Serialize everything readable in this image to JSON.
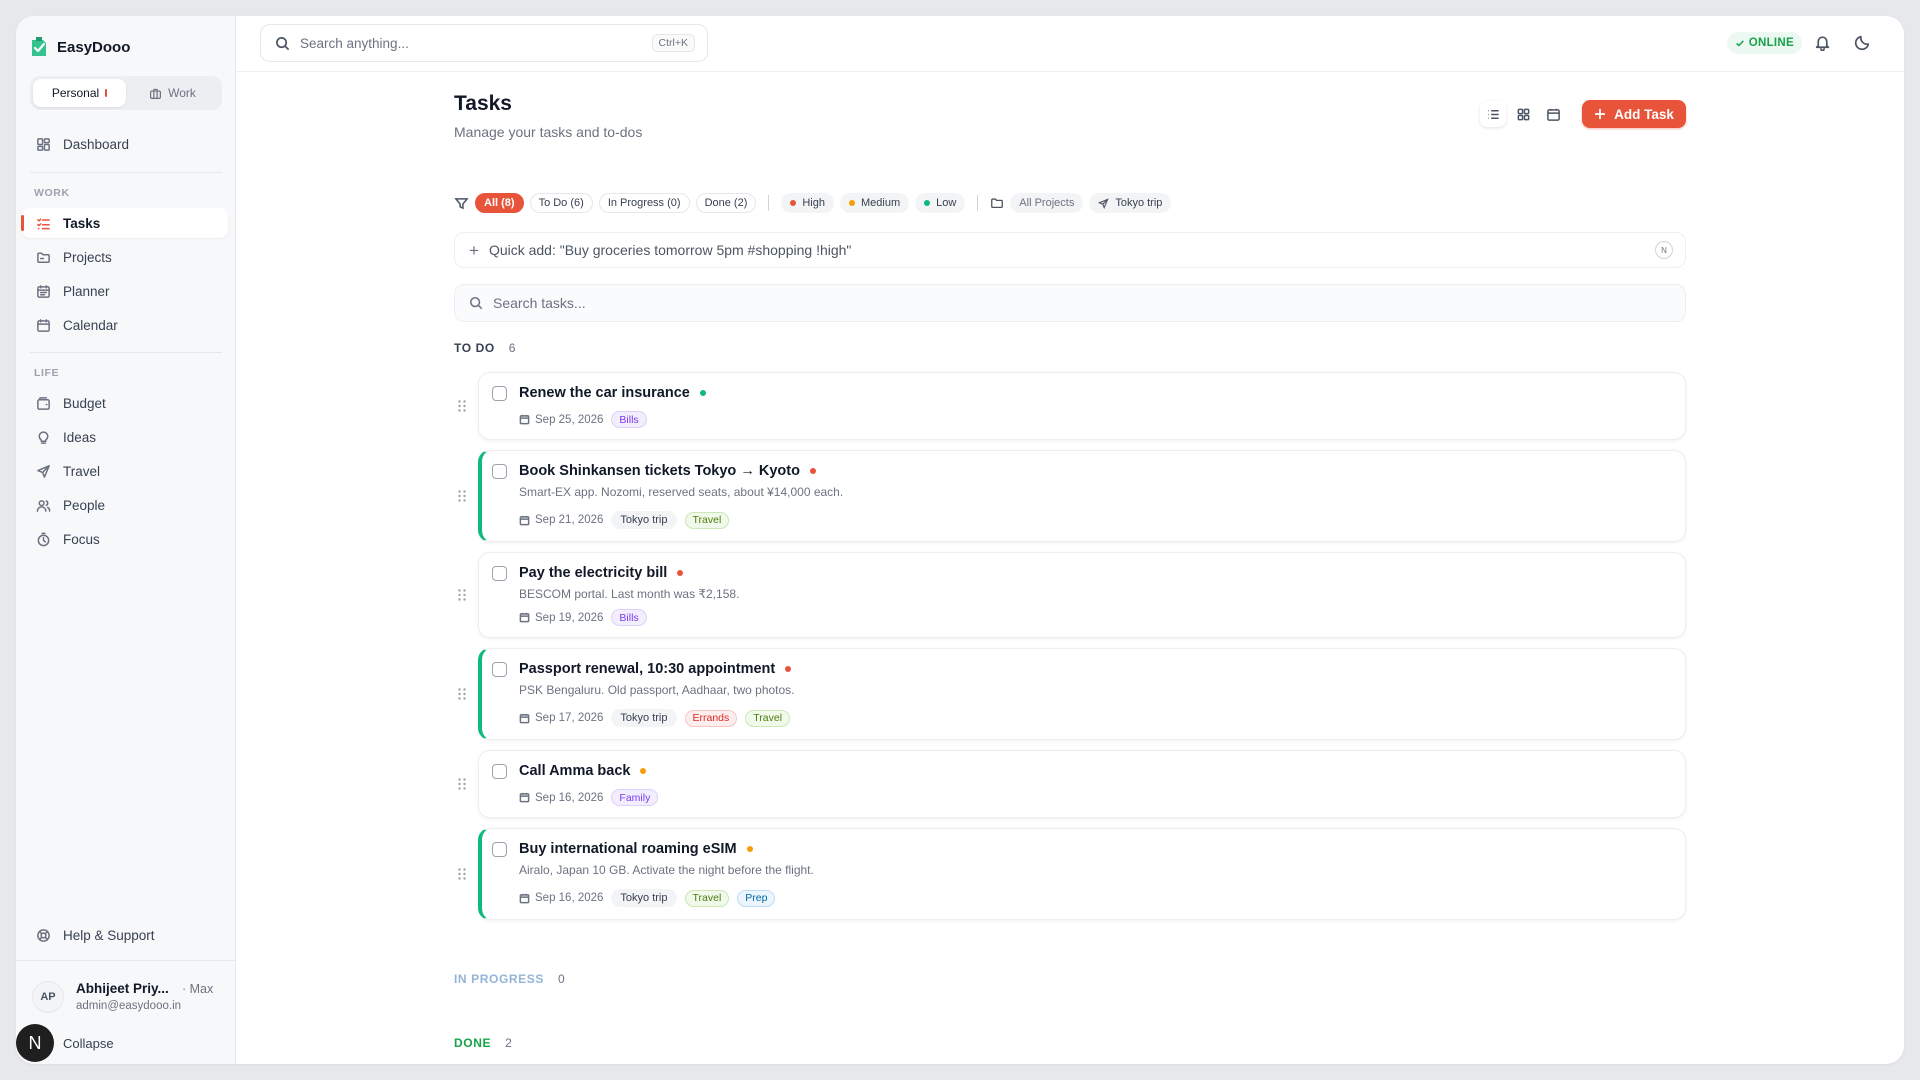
{
  "app": {
    "name": "EasyDooo"
  },
  "switcher": {
    "personal": "Personal",
    "work": "Work"
  },
  "nav": {
    "dashboard": "Dashboard",
    "work_label": "WORK",
    "tasks": "Tasks",
    "projects": "Projects",
    "planner": "Planner",
    "calendar": "Calendar",
    "life_label": "LIFE",
    "budget": "Budget",
    "ideas": "Ideas",
    "travel": "Travel",
    "people": "People",
    "focus": "Focus",
    "help": "Help & Support"
  },
  "user": {
    "initials": "AP",
    "name": "Abhijeet Priy...",
    "plan": "· Max",
    "email": "admin@easydooo.in",
    "collapse": "Collapse",
    "badge": "N"
  },
  "topbar": {
    "search_placeholder": "Search anything...",
    "shortcut": "Ctrl+K",
    "status": "ONLINE"
  },
  "page": {
    "title": "Tasks",
    "subtitle": "Manage your tasks and to-dos",
    "add_task": "Add Task"
  },
  "filters": {
    "status": [
      "All (8)",
      "To Do (6)",
      "In Progress (0)",
      "Done (2)"
    ],
    "priorities": [
      {
        "label": "High",
        "color": "#e8543a"
      },
      {
        "label": "Medium",
        "color": "#f59e0b"
      },
      {
        "label": "Low",
        "color": "#10b981"
      }
    ],
    "all_projects": "All Projects",
    "project": "Tokyo trip"
  },
  "quick_add": {
    "placeholder": "Quick add: \"Buy groceries tomorrow 5pm #shopping !high\"",
    "badge": "N"
  },
  "task_search": {
    "placeholder": "Search tasks..."
  },
  "groups": {
    "todo": {
      "label": "TO DO",
      "count": "6",
      "color": "#374151"
    },
    "in_progress": {
      "label": "IN PROGRESS",
      "count": "0",
      "color": "#93b4d6"
    },
    "done": {
      "label": "DONE",
      "count": "2",
      "color": "#16a34a"
    }
  },
  "tasks": [
    {
      "title": "Renew the car insurance",
      "priority_color": "#10b981",
      "desc": "",
      "date": "Sep 25, 2026",
      "project": "",
      "tags": [
        {
          "label": "Bills",
          "bg": "#f3eefe",
          "fg": "#7c3aed",
          "border": "#ddd0fb"
        }
      ]
    },
    {
      "title": "Book Shinkansen tickets Tokyo → Kyoto",
      "priority_color": "#e8543a",
      "desc": "Smart-EX app. Nozomi, reserved seats, about ¥14,000 each.",
      "date": "Sep 21, 2026",
      "project": "Tokyo trip",
      "tags": [
        {
          "label": "Travel",
          "bg": "#f1f9ea",
          "fg": "#4d7c0f",
          "border": "#cbe7b5"
        }
      ]
    },
    {
      "title": "Pay the electricity bill",
      "priority_color": "#e8543a",
      "desc": "BESCOM portal. Last month was ₹2,158.",
      "date": "Sep 19, 2026",
      "project": "",
      "tags": [
        {
          "label": "Bills",
          "bg": "#f3eefe",
          "fg": "#7c3aed",
          "border": "#ddd0fb"
        }
      ]
    },
    {
      "title": "Passport renewal, 10:30 appointment",
      "priority_color": "#e8543a",
      "desc": "PSK Bengaluru. Old passport, Aadhaar, two photos.",
      "date": "Sep 17, 2026",
      "project": "Tokyo trip",
      "tags": [
        {
          "label": "Errands",
          "bg": "#fdeeee",
          "fg": "#dc2626",
          "border": "#f6c6c6"
        },
        {
          "label": "Travel",
          "bg": "#f1f9ea",
          "fg": "#4d7c0f",
          "border": "#cbe7b5"
        }
      ]
    },
    {
      "title": "Call Amma back",
      "priority_color": "#f59e0b",
      "desc": "",
      "date": "Sep 16, 2026",
      "project": "",
      "tags": [
        {
          "label": "Family",
          "bg": "#f3eefe",
          "fg": "#7c3aed",
          "border": "#ddd0fb"
        }
      ]
    },
    {
      "title": "Buy international roaming eSIM",
      "priority_color": "#f59e0b",
      "desc": "Airalo, Japan 10 GB. Activate the night before the flight.",
      "date": "Sep 16, 2026",
      "project": "Tokyo trip",
      "tags": [
        {
          "label": "Travel",
          "bg": "#f1f9ea",
          "fg": "#4d7c0f",
          "border": "#cbe7b5"
        },
        {
          "label": "Prep",
          "bg": "#ebf5fe",
          "fg": "#0369a1",
          "border": "#bfdcf6"
        }
      ]
    }
  ],
  "colors": {
    "accent": "#e8543a",
    "online": "#16a34a",
    "task_accent": "#10b981"
  }
}
